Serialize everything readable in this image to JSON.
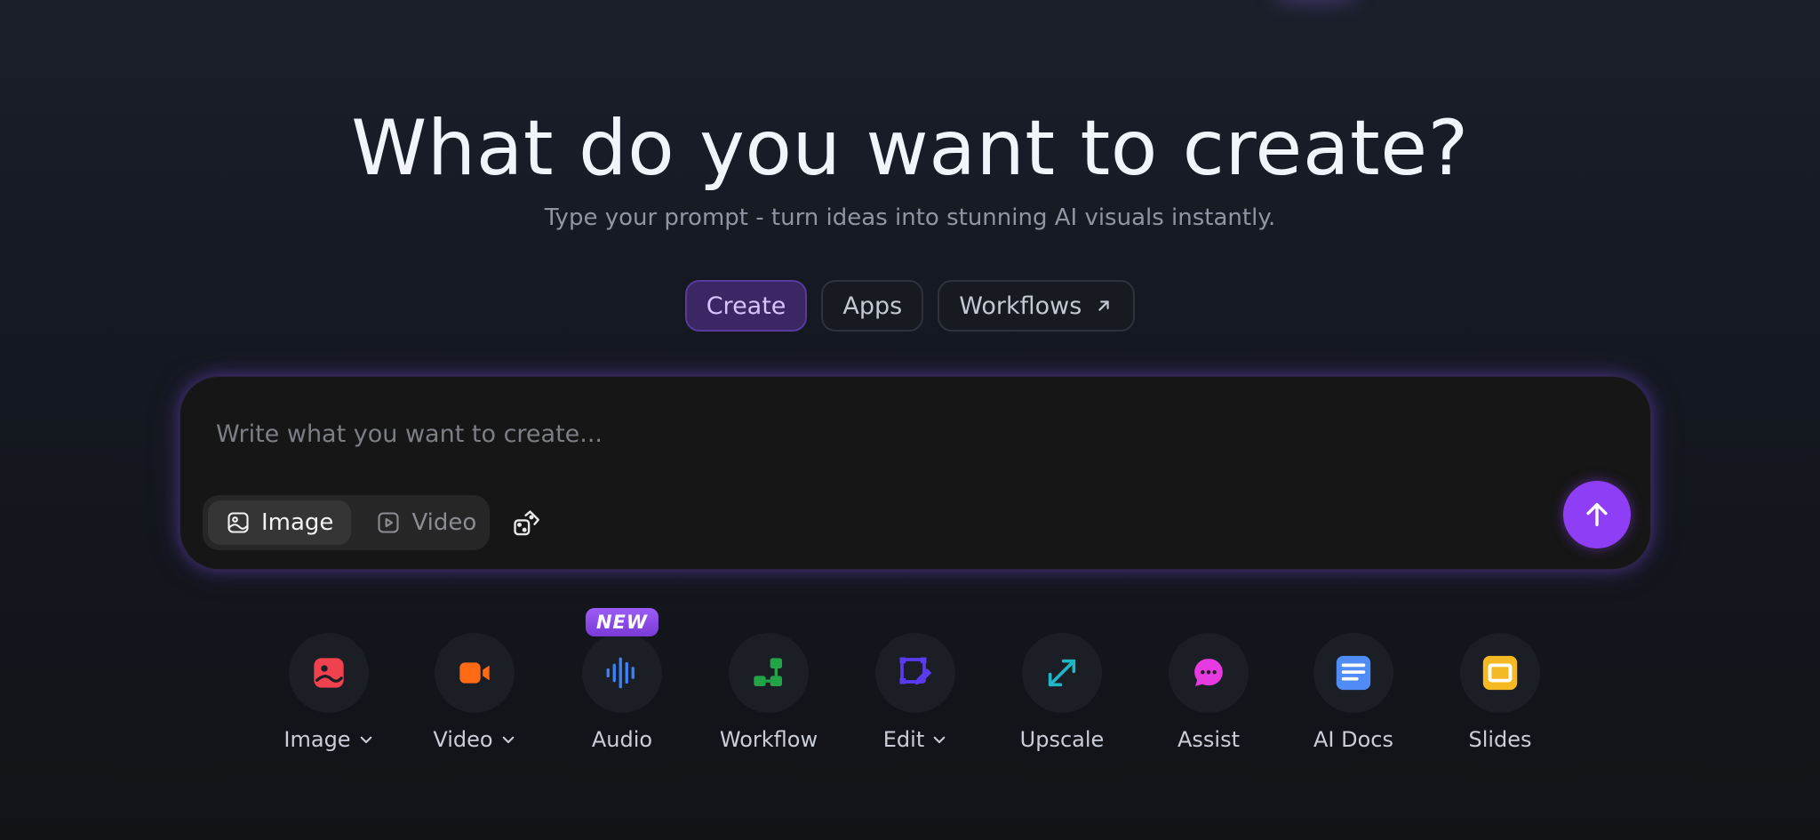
{
  "hero": {
    "title": "What do you want to create?",
    "subtitle": "Type your prompt - turn ideas into stunning AI visuals instantly."
  },
  "tabs": [
    {
      "label": "Create",
      "active": true
    },
    {
      "label": "Apps",
      "active": false
    },
    {
      "label": "Workflows",
      "active": false,
      "icon": "arrow-up-right-icon"
    }
  ],
  "prompt": {
    "placeholder": "Write what you want to create...",
    "value": "",
    "media_options": [
      {
        "label": "Image",
        "icon": "image-icon",
        "active": true
      },
      {
        "label": "Video",
        "icon": "video-icon",
        "active": false
      }
    ],
    "random_icon": "dice-icon",
    "send_icon": "arrow-up-icon",
    "accent": "#8e3ff5"
  },
  "tools": [
    {
      "label": "Image",
      "icon": "image-tool-icon",
      "color": "#f0414f",
      "dropdown": true
    },
    {
      "label": "Video",
      "icon": "video-tool-icon",
      "color": "#ff6a14",
      "dropdown": true
    },
    {
      "label": "Audio",
      "icon": "audio-wave-icon",
      "color": "#3b82f6",
      "badge": "NEW"
    },
    {
      "label": "Workflow",
      "icon": "workflow-icon",
      "color": "#22a447"
    },
    {
      "label": "Edit",
      "icon": "edit-icon",
      "color": "#5a3bf0",
      "dropdown": true
    },
    {
      "label": "Upscale",
      "icon": "upscale-icon",
      "color": "#20b6c6"
    },
    {
      "label": "Assist",
      "icon": "chat-icon",
      "color": "#e53be0"
    },
    {
      "label": "AI Docs",
      "icon": "docs-icon",
      "color": "#4f8cf5"
    },
    {
      "label": "Slides",
      "icon": "slides-icon",
      "color": "#f5b923"
    }
  ]
}
